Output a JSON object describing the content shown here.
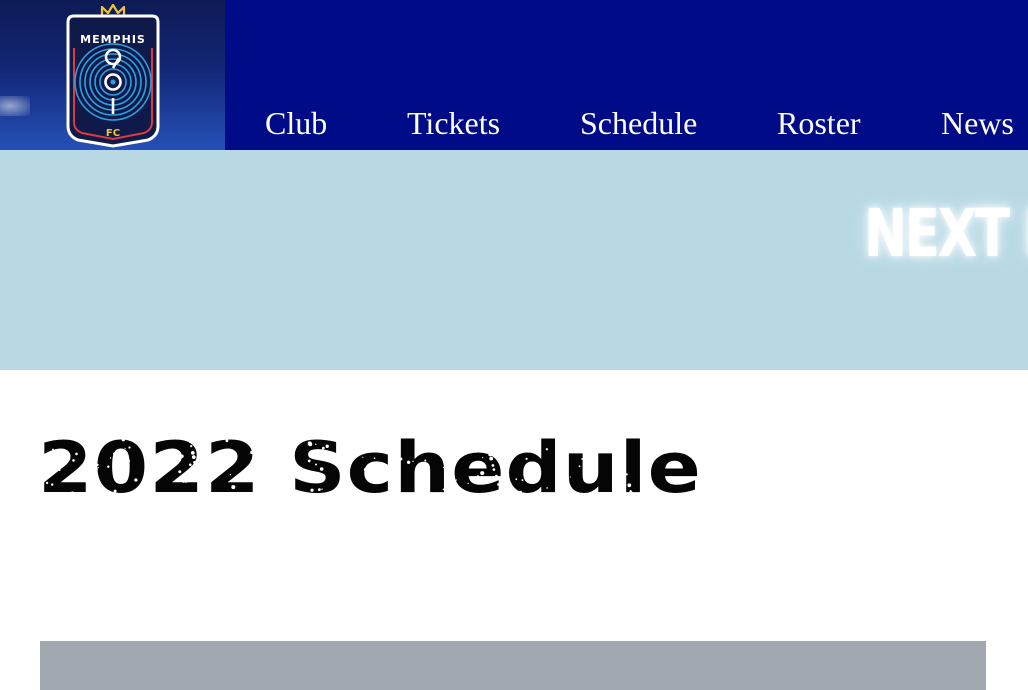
{
  "header": {
    "logo": {
      "icon": "memphis-901-fc-crest",
      "text_top": "MEMPHIS",
      "text_center": "901",
      "text_bottom": "FC",
      "colors": {
        "shield": "#0f1a4a",
        "outline": "#ffffff",
        "rings": "#2ea0e0",
        "accent": "#e23a3a",
        "crown": "#f2c230"
      }
    },
    "background_color": "#000b87",
    "nav": [
      {
        "label": "Club"
      },
      {
        "label": "Tickets"
      },
      {
        "label": "Schedule"
      },
      {
        "label": "Roster"
      },
      {
        "label": "News"
      }
    ]
  },
  "hero": {
    "text": "NEXT H",
    "background_color": "#b8d9e4"
  },
  "main": {
    "title": "2022 Schedule",
    "panel_color": "#a2a8af"
  }
}
